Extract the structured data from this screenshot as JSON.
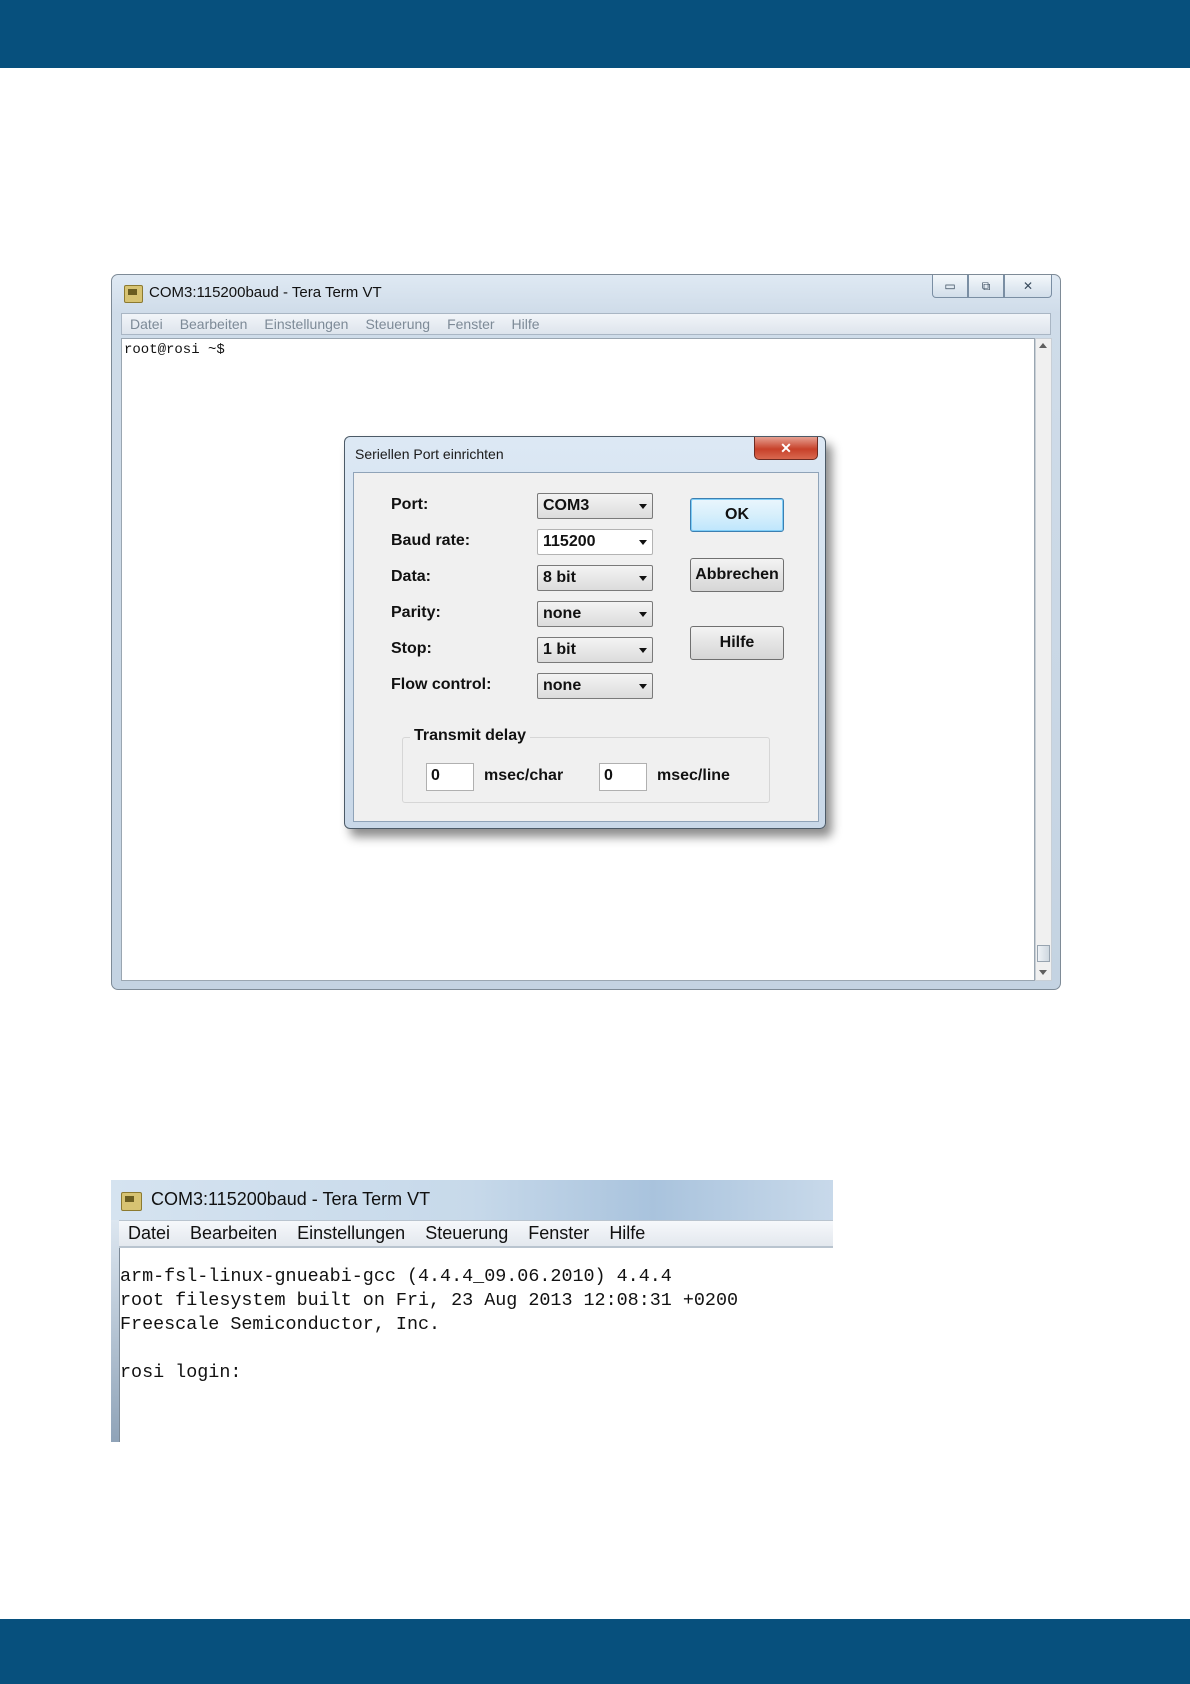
{
  "window1": {
    "title": "COM3:115200baud - Tera Term VT",
    "caption_buttons": [
      "minimize-icon",
      "restore-icon",
      "close-icon"
    ],
    "menu": [
      "Datei",
      "Bearbeiten",
      "Einstellungen",
      "Steuerung",
      "Fenster",
      "Hilfe"
    ],
    "terminal_line": "root@rosi ~$"
  },
  "dialog": {
    "title": "Seriellen Port einrichten",
    "close_glyph": "✕",
    "fields": [
      {
        "label": "Port:",
        "value": "COM3"
      },
      {
        "label": "Baud rate:",
        "value": "115200"
      },
      {
        "label": "Data:",
        "value": "8 bit"
      },
      {
        "label": "Parity:",
        "value": "none"
      },
      {
        "label": "Stop:",
        "value": "1 bit"
      },
      {
        "label": "Flow control:",
        "value": "none"
      }
    ],
    "buttons": {
      "ok": "OK",
      "cancel": "Abbrechen",
      "help": "Hilfe"
    },
    "transmit_delay": {
      "title": "Transmit delay",
      "char_value": "0",
      "char_unit": "msec/char",
      "line_value": "0",
      "line_unit": "msec/line"
    }
  },
  "window2": {
    "title": "COM3:115200baud - Tera Term VT",
    "menu": [
      "Datei",
      "Bearbeiten",
      "Einstellungen",
      "Steuerung",
      "Fenster",
      "Hilfe"
    ],
    "lines": [
      "arm-fsl-linux-gnueabi-gcc (4.4.4_09.06.2010) 4.4.4",
      "root filesystem built on Fri, 23 Aug 2013 12:08:31 +0200",
      "Freescale Semiconductor, Inc.",
      "",
      "rosi login:"
    ]
  },
  "colors": {
    "band": "#07507d",
    "window_frame": "#c9d8e8",
    "dialog_close": "#c7412a"
  }
}
